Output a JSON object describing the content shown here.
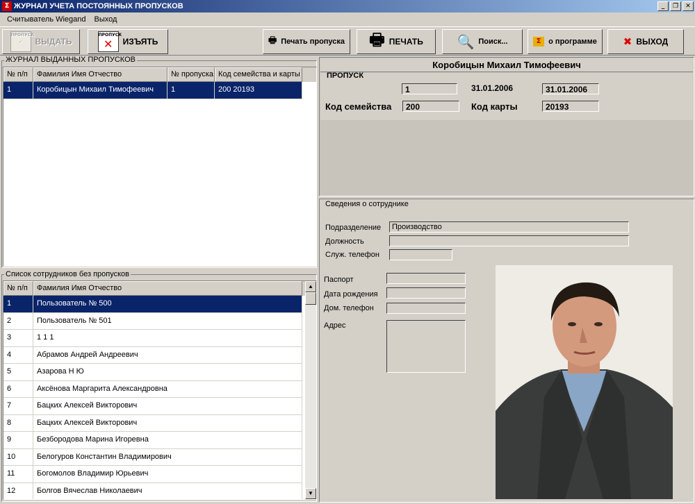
{
  "window": {
    "title": "ЖУРНАЛ УЧЕТА ПОСТОЯННЫХ ПРОПУСКОВ"
  },
  "menu": {
    "items": [
      {
        "label": "Считыватель Wiegand"
      },
      {
        "label": "Выход"
      }
    ]
  },
  "toolbar": {
    "issue_label": "ВЫДАТЬ",
    "issue_icon_text": "ПРОПУСК",
    "revoke_label": "ИЗЪЯТЬ",
    "revoke_icon_text": "ПРОПУСК",
    "print_pass_label": "Печать пропуска",
    "print_label": "ПЕЧАТЬ",
    "search_label": "Поиск...",
    "about_label": "о программе",
    "exit_label": "ВЫХОД"
  },
  "journal": {
    "title": "ЖУРНАЛ ВЫДАННЫХ ПРОПУСКОВ",
    "columns": [
      "№ п/п",
      "Фамилия Имя Отчество",
      "№ пропуска",
      "Код семейства и карты"
    ],
    "rows": [
      {
        "num": "1",
        "name": "Коробицын Михаил Тимофеевич",
        "pass": "1",
        "code": "200 20193"
      }
    ]
  },
  "pass": {
    "person_name": "Коробицын Михаил Тимофеевич",
    "section_title": "ПРОПУСК",
    "pass_number": "1",
    "date_issued": "31.01.2006",
    "date_field": "31.01.2006",
    "family_label": "Код семейства",
    "family_code": "200",
    "card_label": "Код карты",
    "card_code": "20193"
  },
  "employee": {
    "section_title": "Сведения о сотруднике",
    "department_label": "Подразделение",
    "department": "Производство",
    "position_label": "Должность",
    "position": "",
    "work_phone_label": "Служ. телефон",
    "work_phone": "",
    "passport_label": "Паспорт",
    "passport": "",
    "birth_label": "Дата рождения",
    "birth": "",
    "home_phone_label": "Дом. телефон",
    "home_phone": "",
    "address_label": "Адрес",
    "address": ""
  },
  "staff": {
    "title": "Список сотрудников без пропусков",
    "columns": [
      "№ п/п",
      "Фамилия Имя Отчество"
    ],
    "rows": [
      {
        "num": "1",
        "name": "Пользователь № 500"
      },
      {
        "num": "2",
        "name": "Пользователь № 501"
      },
      {
        "num": "3",
        "name": "1 1 1"
      },
      {
        "num": "4",
        "name": "Абрамов Андрей Андреевич"
      },
      {
        "num": "5",
        "name": "Азарова Н Ю"
      },
      {
        "num": "6",
        "name": "Аксёнова Маргарита Александровна"
      },
      {
        "num": "7",
        "name": "Бацких Алексей Викторович"
      },
      {
        "num": "8",
        "name": "Бацких Алексей Викторович"
      },
      {
        "num": "9",
        "name": "Безбородова Марина Игоревна"
      },
      {
        "num": "10",
        "name": "Белогуров Константин Владимирович"
      },
      {
        "num": "11",
        "name": "Богомолов Владимир Юрьевич"
      },
      {
        "num": "12",
        "name": "Болгов Вячеслав Николаевич"
      }
    ]
  }
}
